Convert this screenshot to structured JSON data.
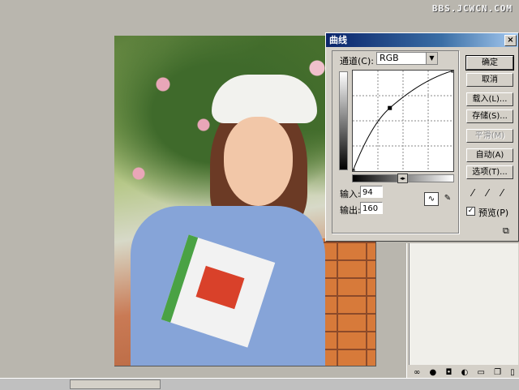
{
  "watermark": "BBS.JCWCN.COM",
  "dialog": {
    "title": "曲线",
    "close_label": "×",
    "channel_label": "通道(C):",
    "channel_value": "RGB",
    "input_label": "输入:",
    "input_value": "94",
    "output_label": "输出:",
    "output_value": "160",
    "buttons": {
      "ok": "确定",
      "cancel": "取消",
      "load": "载入(L)...",
      "save": "存储(S)...",
      "smooth": "平滑(M)",
      "auto": "自动(A)",
      "options": "选项(T)..."
    },
    "preview_label": "预览(P)",
    "preview_checked": "✓",
    "icons": {
      "curve_tool": "curve-icon",
      "pencil_tool": "pencil-icon",
      "black_eyedropper": "eyedropper-icon",
      "gray_eyedropper": "eyedropper-icon",
      "white_eyedropper": "eyedropper-icon"
    }
  },
  "curve": {
    "points": [
      [
        0,
        0
      ],
      [
        94,
        160
      ],
      [
        255,
        255
      ]
    ]
  },
  "palette": {
    "icons": [
      "link-icon",
      "layer-style-icon",
      "mask-icon",
      "adjustment-icon",
      "folder-icon",
      "new-layer-icon",
      "trash-icon"
    ]
  }
}
